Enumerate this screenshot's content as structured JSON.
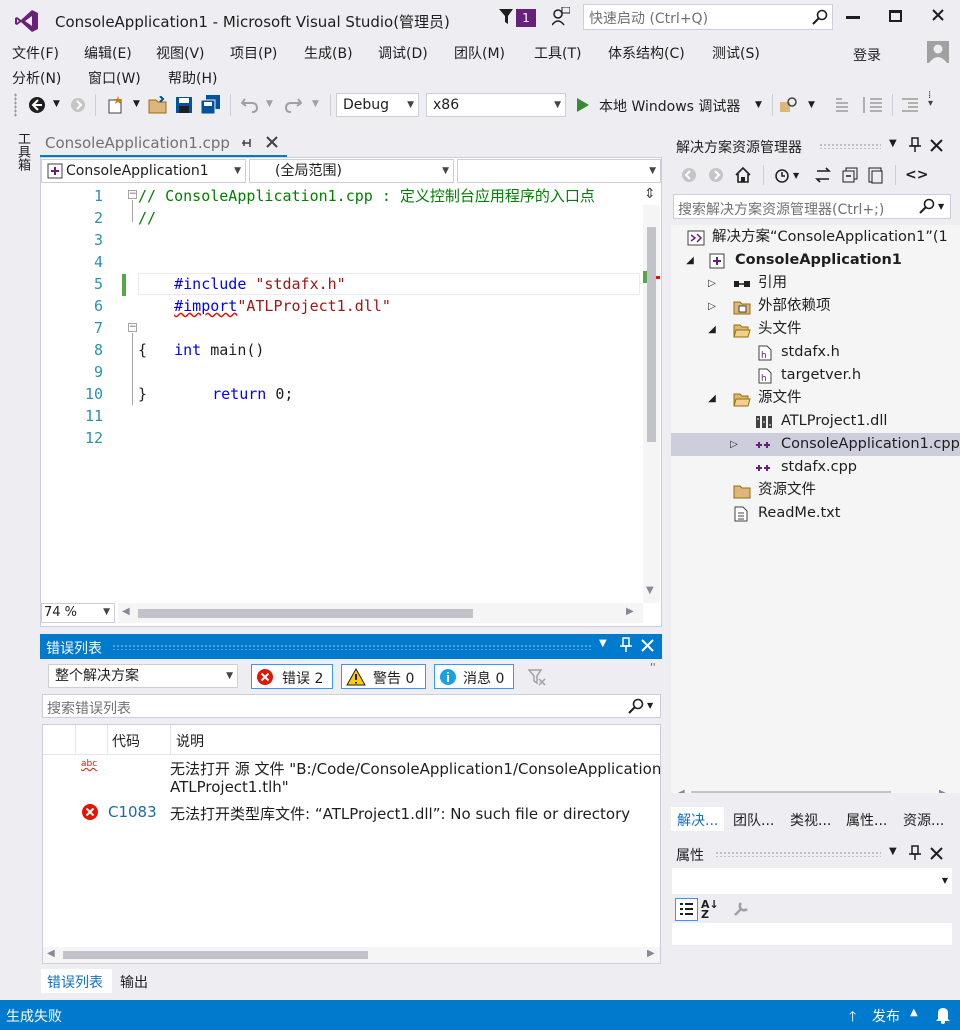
{
  "window": {
    "title": "ConsoleApplication1 - Microsoft Visual Studio(管理员)",
    "notification_count": "1",
    "quick_launch_placeholder": "快速启动 (Ctrl+Q)",
    "login": "登录"
  },
  "menu": {
    "row1": [
      "文件(F)",
      "编辑(E)",
      "视图(V)",
      "项目(P)",
      "生成(B)",
      "调试(D)",
      "团队(M)",
      "工具(T)",
      "体系结构(C)",
      "测试(S)"
    ],
    "row2": [
      "分析(N)",
      "窗口(W)",
      "帮助(H)"
    ]
  },
  "toolbar": {
    "config": "Debug",
    "platform": "x86",
    "run_label": "本地 Windows 调试器"
  },
  "toolbox": {
    "label": "工具箱"
  },
  "editor": {
    "tab_title": "ConsoleApplication1.cpp",
    "nav_project": "ConsoleApplication1",
    "nav_scope": "(全局范围)",
    "nav_member": "",
    "zoom": "74 %",
    "lines": [
      "1",
      "2",
      "3",
      "4",
      "5",
      "6",
      "7",
      "8",
      "9",
      "10",
      "11",
      "12"
    ],
    "code": {
      "l1": "// ConsoleApplication1.cpp : 定义控制台应用程序的入口点",
      "l2": "//",
      "l4_kw": "#include",
      "l4_str": " \"stdafx.h\"",
      "l5_kw": "#import",
      "l5_str": "\"ATLProject1.dll\"",
      "l7_kw": "int",
      "l7_rest": " main()",
      "l8": "{",
      "l9_kw": "return",
      "l9_rest": " 0;",
      "l10": "}"
    }
  },
  "error_list": {
    "title": "错误列表",
    "scope": "整个解决方案",
    "errors_label": "错误 2",
    "warnings_label": "警告 0",
    "messages_label": "消息 0",
    "search_placeholder": "搜索错误列表",
    "columns": {
      "code": "代码",
      "description": "说明"
    },
    "rows": [
      {
        "code": "",
        "description_line1": "无法打开 源 文件 \"B:/Code/ConsoleApplication1/ConsoleApplication",
        "description_line2": "ATLProject1.tlh\""
      },
      {
        "code": "C1083",
        "description_line1": "无法打开类型库文件: “ATLProject1.dll”: No such file or directory",
        "description_line2": ""
      }
    ],
    "tabs": [
      "错误列表",
      "输出"
    ]
  },
  "solution_explorer": {
    "title": "解决方案资源管理器",
    "search_placeholder": "搜索解决方案资源管理器(Ctrl+;)",
    "items": [
      {
        "label": "解决方案“ConsoleApplication1”(1"
      },
      {
        "label": "ConsoleApplication1"
      },
      {
        "label": "引用"
      },
      {
        "label": "外部依赖项"
      },
      {
        "label": "头文件"
      },
      {
        "label": "stdafx.h"
      },
      {
        "label": "targetver.h"
      },
      {
        "label": "源文件"
      },
      {
        "label": "ATLProject1.dll"
      },
      {
        "label": "ConsoleApplication1.cpp"
      },
      {
        "label": "stdafx.cpp"
      },
      {
        "label": "资源文件"
      },
      {
        "label": "ReadMe.txt"
      }
    ],
    "tabs": [
      "解决...",
      "团队...",
      "类视...",
      "属性...",
      "资源..."
    ]
  },
  "properties": {
    "title": "属性"
  },
  "status": {
    "text": "生成失败",
    "publish": "发布"
  },
  "colors": {
    "accent": "#007acc",
    "status_bar": "#007acc",
    "error_red": "#e51400",
    "comment_green": "#008000",
    "keyword_blue": "#0000ff",
    "string_red": "#a31515",
    "vs_purple": "#68217a"
  }
}
